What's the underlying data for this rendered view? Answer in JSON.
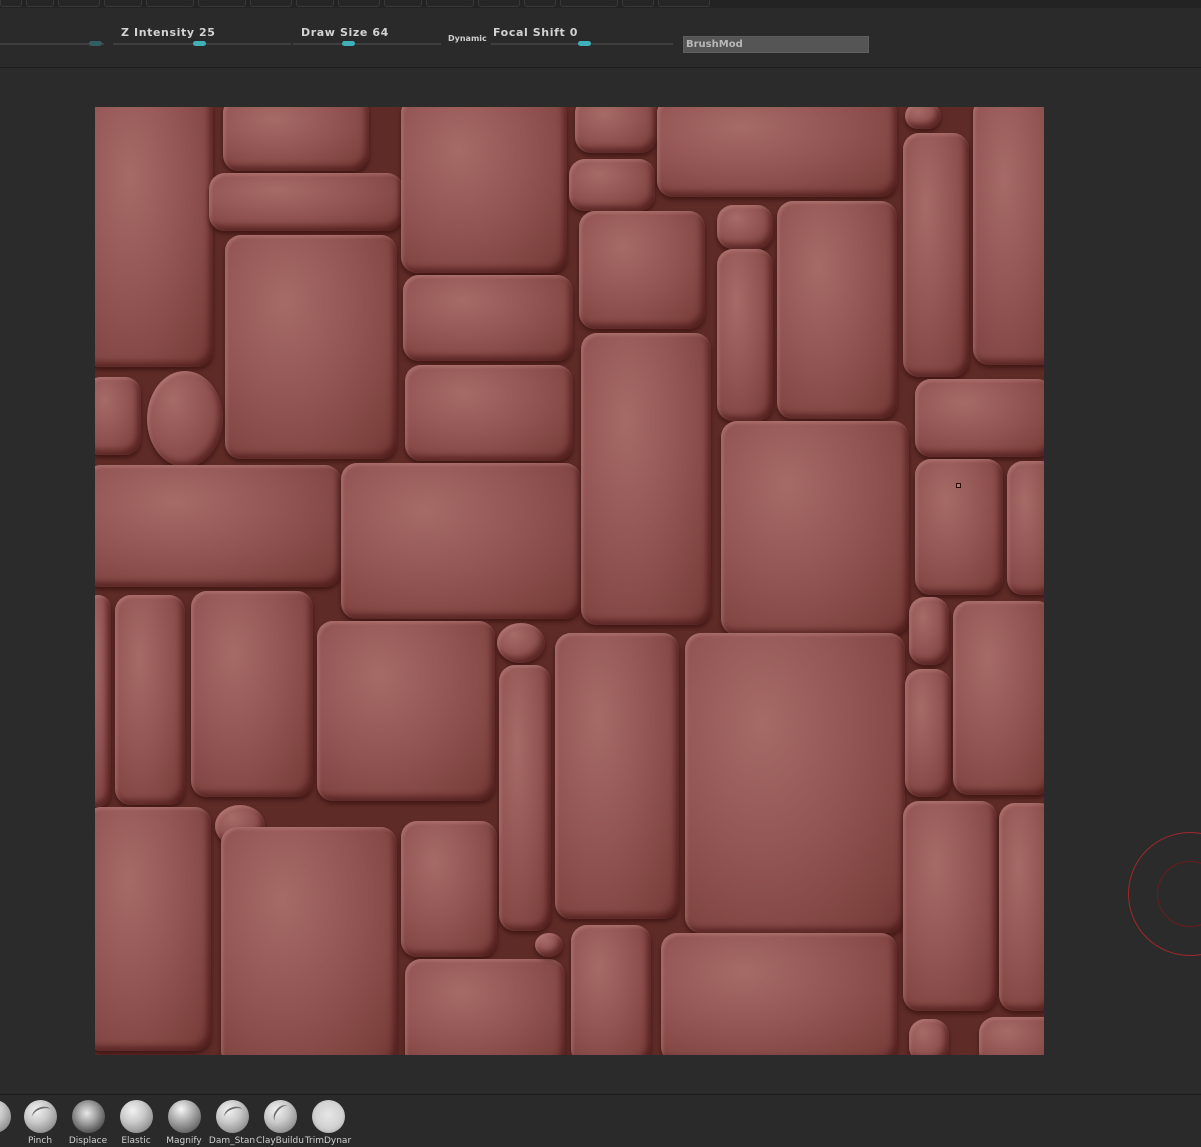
{
  "toolbar": {
    "z_intensity": {
      "label": "Z Intensity 25",
      "fraction": 0.52
    },
    "draw_size": {
      "label": "Draw Size 64",
      "fraction": 0.34
    },
    "dynamic_label": "Dynamic",
    "focal_shift": {
      "label": "Focal Shift 0",
      "fraction": 0.5
    },
    "brush_field_value": "BrushMod"
  },
  "canvas": {
    "document_color": "#925553",
    "brush_cursor_color": "#a0282a"
  },
  "brush_shelf": {
    "brushes": [
      {
        "name": "",
        "icon": "brush-partial-icon"
      },
      {
        "name": "Pinch",
        "icon": "pinch-brush-icon"
      },
      {
        "name": "Displace",
        "icon": "displace-brush-icon"
      },
      {
        "name": "Elastic",
        "icon": "elastic-brush-icon"
      },
      {
        "name": "Magnify",
        "icon": "magnify-brush-icon"
      },
      {
        "name": "Dam_Stan",
        "icon": "dam-standard-brush-icon"
      },
      {
        "name": "ClayBuildu",
        "icon": "clay-buildup-brush-icon"
      },
      {
        "name": "TrimDynar",
        "icon": "trim-dynamic-brush-icon"
      }
    ]
  },
  "colors": {
    "accent": "#3fb0b8",
    "background": "#2b2b2b"
  }
}
